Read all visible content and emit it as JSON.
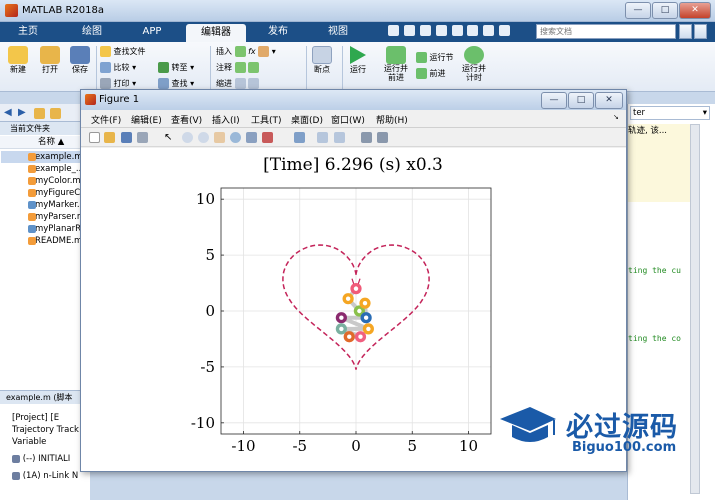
{
  "window": {
    "title": "MATLAB R2018a",
    "min": "—",
    "max": "□",
    "close": "✕"
  },
  "tabs": [
    "主页",
    "绘图",
    "APP",
    "编辑器",
    "发布",
    "视图"
  ],
  "active_tab": "编辑器",
  "search": {
    "placeholder": "搜索文档"
  },
  "ribbon": {
    "new": "新建",
    "open": "打开",
    "save": "保存",
    "find_files": "查找文件",
    "compare": "比较",
    "print": "打印",
    "insert": "插入",
    "fx": "fx",
    "goto": "转至",
    "comment": "注释",
    "find": "查找",
    "indent": "缩进",
    "breakpoints": "断点",
    "run": "运行",
    "run_advance": "运行并\n前进",
    "run_section": "运行节",
    "advance": "前进",
    "run_time": "运行并\n计时"
  },
  "left_panel": {
    "header": "当前文件夹",
    "col_header": "名称 ▲",
    "files": [
      "example.m",
      "example_...",
      "myColor.m",
      "myFigureC...",
      "myMarker...",
      "myParser.m",
      "myPlanarR...",
      "README.m..."
    ]
  },
  "bottom_panel": {
    "header": "example.m  (脚本",
    "lines": [
      "[Project]      [E",
      "Trajectory Track",
      "Variable",
      "(--) INITIALI",
      "(1A) n-Link N"
    ]
  },
  "right_panel": {
    "dropdown": "ter",
    "snippet1": "轨迹, 该...",
    "code1": "ting the cu",
    "code2": "ting the co"
  },
  "figure": {
    "title": "Figure 1",
    "menu": [
      "文件(F)",
      "编辑(E)",
      "查看(V)",
      "插入(I)",
      "工具(T)",
      "桌面(D)",
      "窗口(W)",
      "帮助(H)"
    ]
  },
  "watermark": {
    "cn": "必过源码",
    "en": "Biguo100.com"
  },
  "chart_data": {
    "type": "line",
    "title": "[Time] 6.296 (s) x0.3",
    "xlabel": "",
    "ylabel": "",
    "xlim": [
      -12,
      12
    ],
    "ylim": [
      -11,
      11
    ],
    "xticks": [
      -10,
      -5,
      0,
      5,
      10
    ],
    "yticks": [
      -10,
      -5,
      0,
      5,
      10
    ],
    "grid": true,
    "series": [
      {
        "style": "dashed",
        "color": "#c4245a",
        "shape": "heart",
        "params": {
          "scale": 6.5,
          "cy": 1.3
        }
      }
    ],
    "link_points": [
      {
        "x": 0.0,
        "y": 2.0,
        "color": "#f05a78"
      },
      {
        "x": -0.7,
        "y": 1.1,
        "color": "#f5a623"
      },
      {
        "x": 0.3,
        "y": 0.0,
        "color": "#8ac04a"
      },
      {
        "x": 0.8,
        "y": 0.7,
        "color": "#f5a623"
      },
      {
        "x": 0.9,
        "y": -0.6,
        "color": "#2a6db5"
      },
      {
        "x": -1.3,
        "y": -0.6,
        "color": "#8a2a6e"
      },
      {
        "x": 1.1,
        "y": -1.6,
        "color": "#f5a623"
      },
      {
        "x": -1.3,
        "y": -1.6,
        "color": "#7ab0a0"
      },
      {
        "x": 0.4,
        "y": -2.3,
        "color": "#f06080"
      },
      {
        "x": -0.6,
        "y": -2.3,
        "color": "#e06a2a"
      }
    ]
  }
}
